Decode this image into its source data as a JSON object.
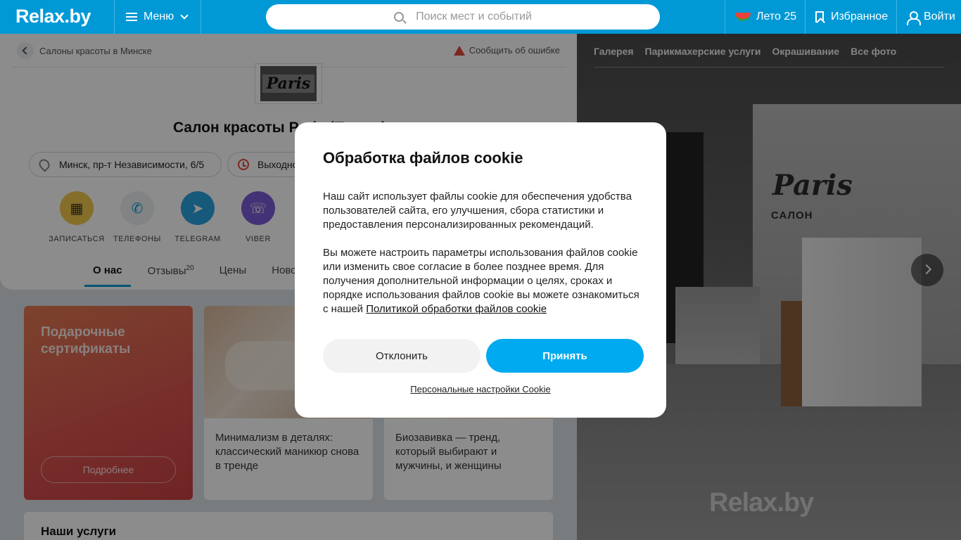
{
  "header": {
    "logo": "Relax.by",
    "menu_label": "Меню",
    "search_placeholder": "Поиск мест и событий",
    "summer_label": "Лето 25",
    "favorites_label": "Избранное",
    "login_label": "Войти"
  },
  "page": {
    "breadcrumb": "Салоны красоты в Минске",
    "report_label": "Сообщить об ошибке",
    "salon_logo_text": "Paris",
    "title": "Салон красоты Paris (Париж)",
    "address": "Минск, пр-т Независимости, 6/5",
    "hours": "Выходной",
    "actions": [
      {
        "label": "ЗАПИСАТЬСЯ",
        "icon": "calendar-icon",
        "color": "#f2c94c"
      },
      {
        "label": "ТЕЛЕФОНЫ",
        "icon": "phone-icon",
        "color": "#eceef0"
      },
      {
        "label": "TELEGRAM",
        "icon": "telegram-icon",
        "color": "#2aa3df"
      },
      {
        "label": "VIBER",
        "icon": "viber-icon",
        "color": "#7b5cd6"
      }
    ],
    "tabs": [
      {
        "label": "О нас"
      },
      {
        "label": "Отзывы",
        "count": "20"
      },
      {
        "label": "Цены"
      },
      {
        "label": "Новости"
      }
    ],
    "gift": {
      "title": "Подарочные сертификаты",
      "button": "Подробнее"
    },
    "articles": [
      {
        "text": "Минимализм в деталях: классический маникюр снова в тренде"
      },
      {
        "text": "Биозавивка — тренд, который выбирают и мужчины, и женщины"
      }
    ],
    "services_title": "Наши услуги"
  },
  "gallery": {
    "tabs": [
      "Галерея",
      "Парикмахерские услуги",
      "Окрашивание",
      "Все фото"
    ],
    "photo_sign": "Paris",
    "photo_sign_sub": "САЛОН",
    "watermark": "Relax.by"
  },
  "cookie_modal": {
    "title": "Обработка файлов cookie",
    "paragraph1": "Наш сайт использует файлы cookie для обеспечения удобства пользователей сайта, его улучшения, сбора статистики и предоставления персонализированных рекомендаций.",
    "paragraph2": "Вы можете настроить параметры использования файлов cookie или изменить свое согласие в более позднее время. Для получения дополнительной информации о целях, сроках и порядке использования файлов cookie вы можете ознакомиться с нашей",
    "policy_link": "Политикой обработки файлов cookie",
    "decline_label": "Отклонить",
    "accept_label": "Принять",
    "settings_label": "Персональные настройки Cookie"
  }
}
